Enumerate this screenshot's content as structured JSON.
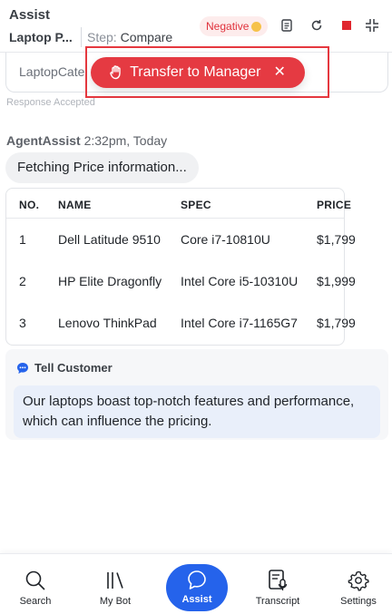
{
  "header": {
    "title": "Assist",
    "intent": "Laptop P...",
    "step_label": "Step:",
    "step_value": "Compare",
    "sentiment": "Negative"
  },
  "field": {
    "value": "LaptopCate"
  },
  "status": "Response Accepted",
  "transfer": {
    "label": "Transfer to Manager",
    "close": "✕"
  },
  "message": {
    "author": "AgentAssist",
    "time": "2:32pm, Today",
    "text": "Fetching Price information..."
  },
  "table": {
    "columns": [
      "NO.",
      "NAME",
      "SPEC",
      "PRICE"
    ],
    "rows": [
      [
        "1",
        "Dell Latitude 9510",
        "Core i7-10810U",
        "$1,799"
      ],
      [
        "2",
        "HP Elite Dragonfly",
        "Intel Core i5-10310U",
        "$1,999"
      ],
      [
        "3",
        "Lenovo ThinkPad",
        "Intel Core i7-1165G7",
        "$1,799"
      ]
    ]
  },
  "tell_customer": {
    "title": "Tell Customer",
    "text": "Our laptops boast top-notch features and performance, which can influence the pricing."
  },
  "nav": {
    "search": "Search",
    "mybot": "My Bot",
    "assist": "Assist",
    "transcript": "Transcript",
    "settings": "Settings"
  },
  "colors": {
    "accent": "#2563eb",
    "danger": "#e53a42",
    "stop": "#e0262e"
  }
}
